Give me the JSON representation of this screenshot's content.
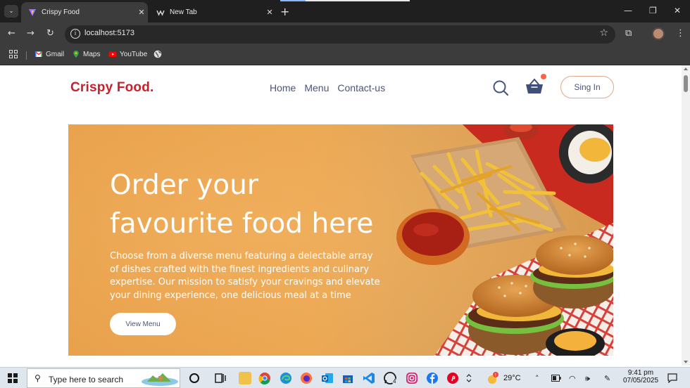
{
  "browser": {
    "tabs": [
      {
        "title": "Crispy Food",
        "active": true
      },
      {
        "title": "New Tab",
        "active": false
      }
    ],
    "url": "localhost:5173",
    "bookmarks": [
      {
        "label": "Gmail",
        "icon": "gmail-icon"
      },
      {
        "label": "Maps",
        "icon": "maps-icon"
      },
      {
        "label": "YouTube",
        "icon": "youtube-icon"
      }
    ]
  },
  "site": {
    "logo": "Crispy Food.",
    "nav": [
      "Home",
      "Menu",
      "Contact-us"
    ],
    "signin_label": "Sing In",
    "hero": {
      "title_line1": "Order your",
      "title_line2": "favourite food here",
      "description": "Choose from a diverse menu featuring a delectable array of dishes crafted with the finest ingredients and culinary expertise. Our mission to satisfy your cravings and elevate your dining experience, one delicious meal at a time",
      "button_label": "View Menu"
    },
    "colors": {
      "brand": "#c8202c",
      "nav_text": "#49557e",
      "hero_bg": "#eca752",
      "badge": "#ff6347"
    }
  },
  "taskbar": {
    "search_placeholder": "Type here to search",
    "whatsapp_badge": "4",
    "weather": "29°C",
    "time": "9:41 pm",
    "date": "07/05/2025"
  }
}
